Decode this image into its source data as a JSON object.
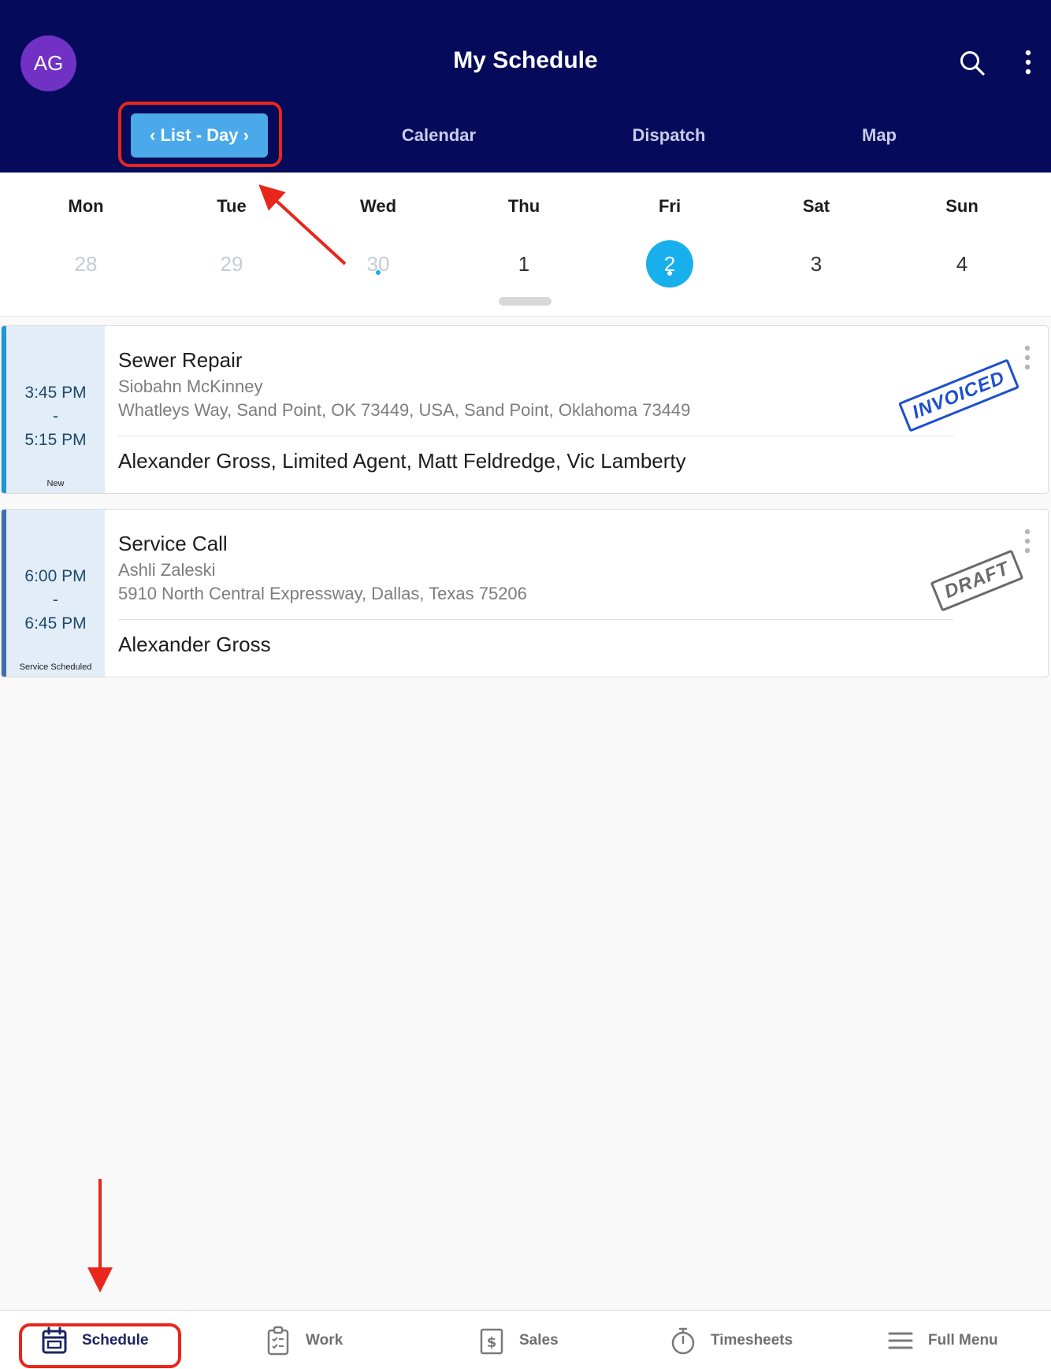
{
  "header": {
    "avatar_initials": "AG",
    "title": "My Schedule",
    "search_icon": "search-icon",
    "more_icon": "more-vertical-icon"
  },
  "tabs": [
    {
      "label": "‹ List - Day ›",
      "active": true
    },
    {
      "label": "Calendar",
      "active": false
    },
    {
      "label": "Dispatch",
      "active": false
    },
    {
      "label": "Map",
      "active": false
    }
  ],
  "week": {
    "days": [
      {
        "name": "Mon",
        "num": "28",
        "state": "past"
      },
      {
        "name": "Tue",
        "num": "29",
        "state": "past"
      },
      {
        "name": "Wed",
        "num": "30",
        "state": "past",
        "has_event": true
      },
      {
        "name": "Thu",
        "num": "1",
        "state": "normal"
      },
      {
        "name": "Fri",
        "num": "2",
        "state": "selected",
        "has_event": true
      },
      {
        "name": "Sat",
        "num": "3",
        "state": "normal"
      },
      {
        "name": "Sun",
        "num": "4",
        "state": "normal"
      }
    ]
  },
  "jobs": [
    {
      "start": "3:45 PM",
      "dash": "-",
      "end": "5:15 PM",
      "status": "New",
      "title": "Sewer Repair",
      "customer": "Siobahn McKinney",
      "address": "Whatleys Way, Sand Point, OK 73449, USA, Sand Point, Oklahoma 73449",
      "techs": "Alexander Gross, Limited Agent, Matt Feldredge, Vic Lamberty",
      "stamp": "INVOICED"
    },
    {
      "start": "6:00 PM",
      "dash": "-",
      "end": "6:45 PM",
      "status": "Service Scheduled",
      "title": "Service Call",
      "customer": "Ashli Zaleski",
      "address": "5910 North Central Expressway, Dallas, Texas 75206",
      "techs": "Alexander Gross",
      "stamp": "DRAFT"
    }
  ],
  "bottom_nav": {
    "schedule": "Schedule",
    "work": "Work",
    "sales": "Sales",
    "timesheets": "Timesheets",
    "full_menu": "Full Menu"
  },
  "colors": {
    "header_bg": "#050a5a",
    "active_tab": "#4aa9e8",
    "selected_day": "#17b0ec",
    "avatar": "#7131c4",
    "annotation": "#e8261b",
    "invoiced_stamp": "#1d4fcf"
  }
}
